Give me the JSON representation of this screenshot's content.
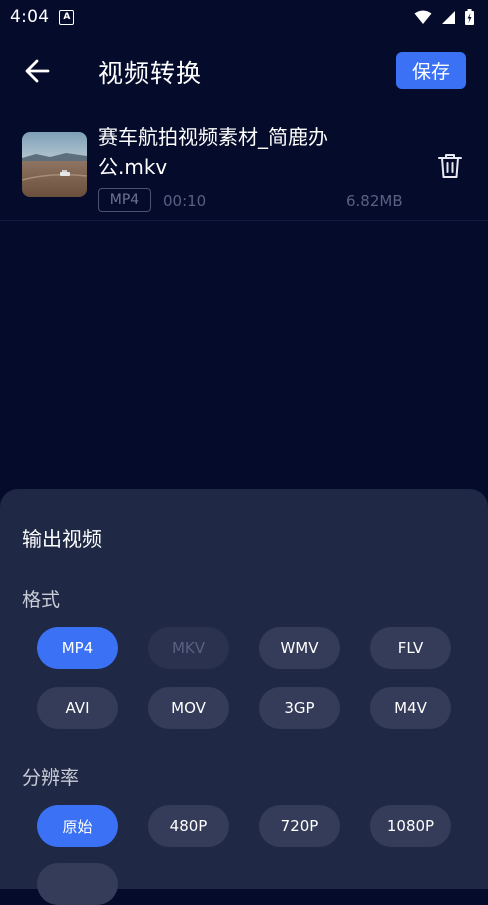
{
  "status": {
    "time": "4:04",
    "notif_glyph": "A"
  },
  "header": {
    "title": "视频转换",
    "save_label": "保存"
  },
  "video": {
    "name": "赛车航拍视频素材_简鹿办公.mkv",
    "format": "MP4",
    "duration": "00:10",
    "size": "6.82MB"
  },
  "sheet": {
    "title": "输出视频",
    "format_label": "格式",
    "formats": [
      {
        "label": "MP4",
        "state": "selected"
      },
      {
        "label": "MKV",
        "state": "disabled"
      },
      {
        "label": "WMV",
        "state": "normal"
      },
      {
        "label": "FLV",
        "state": "normal"
      },
      {
        "label": "AVI",
        "state": "normal"
      },
      {
        "label": "MOV",
        "state": "normal"
      },
      {
        "label": "3GP",
        "state": "normal"
      },
      {
        "label": "M4V",
        "state": "normal"
      }
    ],
    "resolution_label": "分辨率",
    "resolutions": [
      {
        "label": "原始",
        "state": "selected"
      },
      {
        "label": "480P",
        "state": "normal"
      },
      {
        "label": "720P",
        "state": "normal"
      },
      {
        "label": "1080P",
        "state": "normal"
      }
    ]
  },
  "colors": {
    "background": "#050b2b",
    "accent": "#3b72f5",
    "sheet": "#1f2844",
    "chip": "#343c59"
  }
}
